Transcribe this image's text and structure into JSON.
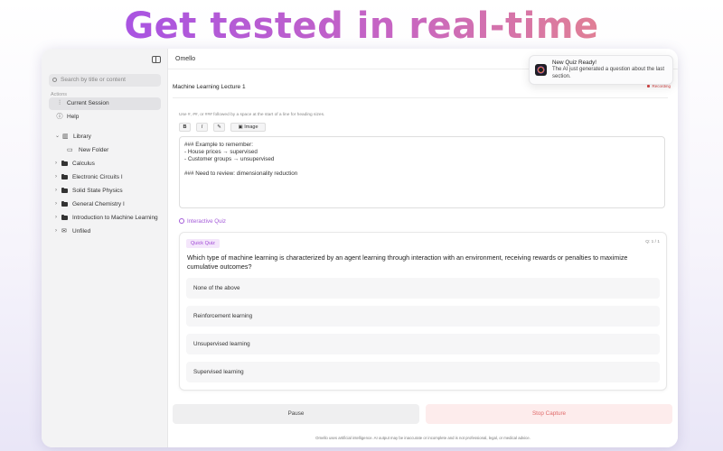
{
  "headline": "Get tested in real-time",
  "sidebar": {
    "search_placeholder": "Search by title or content",
    "actions_label": "Actions",
    "actions": [
      {
        "label": "Current Session",
        "icon": "waveform-icon"
      },
      {
        "label": "Help",
        "icon": "help-icon"
      }
    ],
    "library_label": "Library",
    "library_items": [
      {
        "label": "New Folder",
        "icon": "new-folder-icon"
      },
      {
        "label": "Calculus",
        "icon": "folder-icon"
      },
      {
        "label": "Electronic Circuits I",
        "icon": "folder-icon"
      },
      {
        "label": "Solid State Physics",
        "icon": "folder-icon"
      },
      {
        "label": "General Chemistry I",
        "icon": "folder-icon"
      },
      {
        "label": "Introduction to Machine Learning",
        "icon": "folder-icon"
      },
      {
        "label": "Unfiled",
        "icon": "inbox-icon"
      }
    ]
  },
  "main": {
    "app_title": "Omello",
    "document_title": "Machine Learning Lecture 1",
    "recording_label": "Recording",
    "heading_hint": "Use #, ##, or ### followed by a space at the start of a line for heading sizes.",
    "toolbar": {
      "bold": "B",
      "italic": "I",
      "image": "Image"
    },
    "editor_lines": [
      "### Example to remember:",
      "- House prices → supervised",
      "- Customer groups → unsupervised",
      "",
      "### Need to review: dimensionality reduction"
    ],
    "interactive_quiz_label": "Interactive Quiz",
    "quiz": {
      "badge": "Quick Quiz",
      "counter": "Q: 1 / 1",
      "question": "Which type of machine learning is characterized by an agent learning through interaction with an environment, receiving rewards or penalties to maximize cumulative outcomes?",
      "options": [
        "None of the above",
        "Reinforcement learning",
        "Unsupervised learning",
        "Supervised learning"
      ]
    },
    "pause_label": "Pause",
    "stop_label": "Stop Capture",
    "disclaimer": "Omello uses artificial intelligence. AI output may be inaccurate or incomplete and is not professional, legal, or medical advice."
  },
  "notification": {
    "title": "New Quiz Ready!",
    "body": "The AI just generated a question about the last section."
  },
  "colors": {
    "accent": "#a35ad8",
    "stop": "#e06a6a",
    "recording": "#d54848"
  }
}
